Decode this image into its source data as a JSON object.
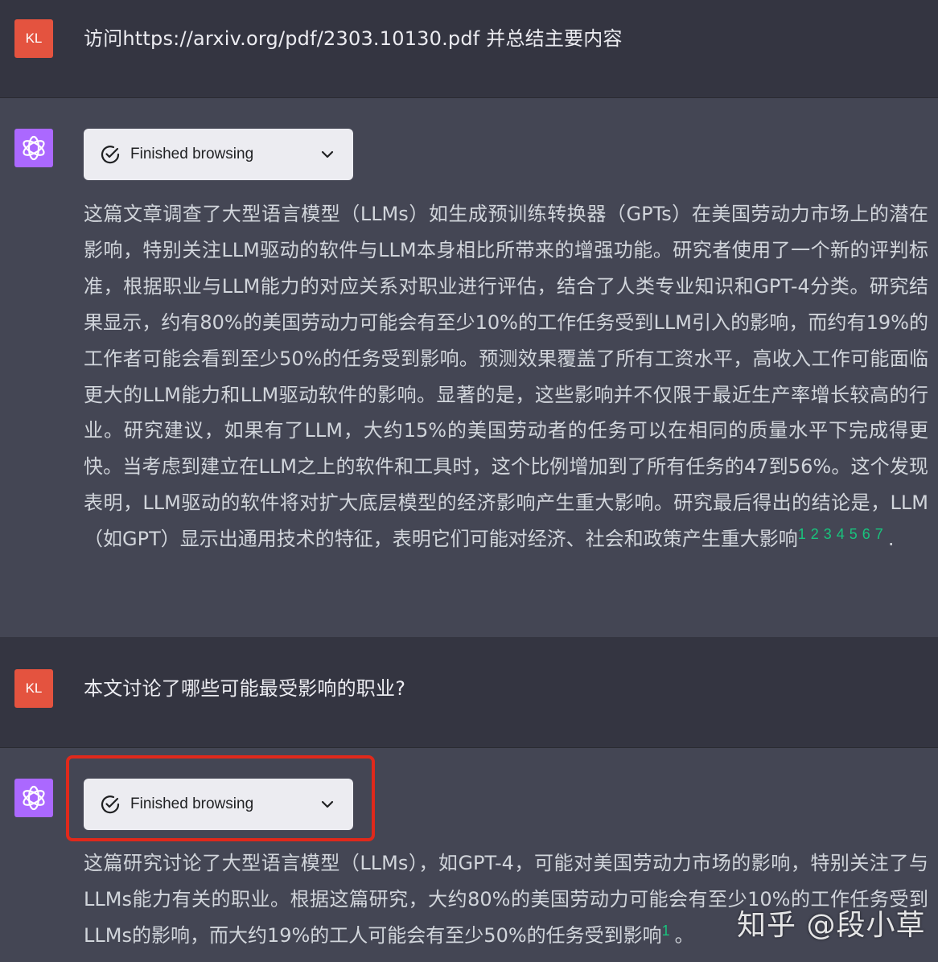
{
  "conversation": {
    "turn1_user": {
      "avatar_text": "KL",
      "text": "访问https://arxiv.org/pdf/2303.10130.pdf 并总结主要内容"
    },
    "turn1_assistant": {
      "status_label": "Finished browsing",
      "answer": "这篇文章调查了大型语言模型（LLMs）如生成预训练转换器（GPTs）在美国劳动力市场上的潜在影响，特别关注LLM驱动的软件与LLM本身相比所带来的增强功能。研究者使用了一个新的评判标准，根据职业与LLM能力的对应关系对职业进行评估，结合了人类专业知识和GPT-4分类。研究结果显示，约有80%的美国劳动力可能会有至少10%的工作任务受到LLM引入的影响，而约有19%的工作者可能会看到至少50%的任务受到影响。预测效果覆盖了所有工资水平，高收入工作可能面临更大的LLM能力和LLM驱动软件的影响。显著的是，这些影响并不仅限于最近生产率增长较高的行业。研究建议，如果有了LLM，大约15%的美国劳动者的任务可以在相同的质量水平下完成得更快。当考虑到建立在LLM之上的软件和工具时，这个比例增加到了所有任务的47到56%。这个发现表明，LLM驱动的软件将对扩大底层模型的经济影响产生重大影响。研究最后得出的结论是，LLM（如GPT）显示出通用技术的特征，表明它们可能对经济、社会和政策产生重大影响",
      "citations": "1234567",
      "end_punct": "."
    },
    "turn2_user": {
      "avatar_text": "KL",
      "text": "本文讨论了哪些可能最受影响的职业?"
    },
    "turn2_assistant": {
      "status_label": "Finished browsing",
      "answer": "这篇研究讨论了大型语言模型（LLMs），如GPT-4，可能对美国劳动力市场的影响，特别关注了与LLMs能力有关的职业。根据这篇研究，大约80%的美国劳动力可能会有至少10%的工作任务受到LLMs的影响，而大约19%的工人可能会有至少50%的任务受到影响",
      "citations": "1",
      "end_punct": "。"
    }
  },
  "watermark": "知乎 @段小草",
  "colors": {
    "user_bg": "#343541",
    "assistant_bg": "#444654",
    "user_avatar": "#e4533f",
    "bot_avatar": "#ab68ff",
    "citation": "#19c37d",
    "highlight_box": "#e0291b"
  }
}
